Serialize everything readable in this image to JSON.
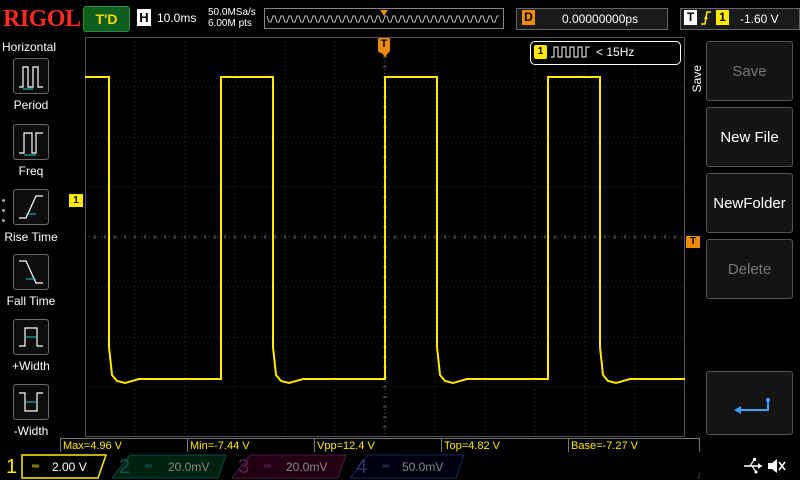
{
  "header": {
    "brand": "RIGOL",
    "run_status": "T'D",
    "timebase_label": "H",
    "timebase_value": "10.0ms",
    "sample_rate": "50.0MSa/s",
    "memory_depth": "6.00M pts",
    "delay_label": "D",
    "delay_value": "0.00000000ps",
    "trigger_label": "T",
    "trigger_source": "1",
    "trigger_level": "-1.60 V"
  },
  "left_panel": {
    "title": "Horizontal",
    "items": [
      {
        "label": "Period",
        "icon": "period-icon"
      },
      {
        "label": "Freq",
        "icon": "freq-icon"
      },
      {
        "label": "Rise Time",
        "icon": "rise-time-icon"
      },
      {
        "label": "Fall Time",
        "icon": "fall-time-icon"
      },
      {
        "label": "+Width",
        "icon": "pos-width-icon"
      },
      {
        "label": "-Width",
        "icon": "neg-width-icon"
      }
    ]
  },
  "freq_counter": {
    "channel": "1",
    "text": "< 15Hz"
  },
  "markers": {
    "ch1_marker": "1",
    "trigger_pos": "T",
    "trigger_level": "T"
  },
  "right_panel": {
    "title": "Save",
    "buttons": [
      {
        "label": "Save",
        "enabled": false
      },
      {
        "label": "New File",
        "enabled": true
      },
      {
        "label": "NewFolder",
        "enabled": true
      },
      {
        "label": "Delete",
        "enabled": false
      },
      {
        "label": "",
        "icon": "enter-icon"
      }
    ]
  },
  "measurements": [
    "Max=4.96 V",
    "Min=-7.44 V",
    "Vpp=12.4 V",
    "Top=4.82 V",
    "Base=-7.27 V"
  ],
  "channels": [
    {
      "num": "1",
      "scale": "2.00 V",
      "color": "#ffea00",
      "active": true
    },
    {
      "num": "2",
      "scale": "20.0mV",
      "color": "#1ec8c8",
      "active": false
    },
    {
      "num": "3",
      "scale": "20.0mV",
      "color": "#e040e0",
      "active": false
    },
    {
      "num": "4",
      "scale": "50.0mV",
      "color": "#3a6ef0",
      "active": false
    }
  ],
  "colors": {
    "accent_yellow": "#ffea00",
    "brand_red": "#ff2a1f",
    "orange": "#f08a00"
  }
}
